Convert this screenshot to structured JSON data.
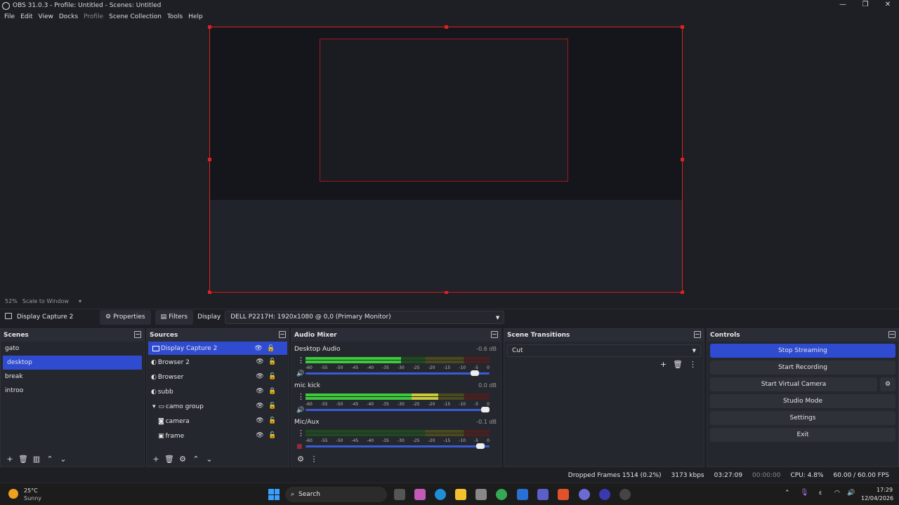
{
  "window": {
    "title": "OBS 31.0.3 - Profile: Untitled - Scenes: Untitled",
    "controls": [
      "—",
      "❐",
      "✕"
    ]
  },
  "menu": [
    "File",
    "Edit",
    "View",
    "Docks",
    "Profile",
    "Scene Collection",
    "Tools",
    "Help"
  ],
  "preview": {
    "zoom": "52%",
    "scale_mode": "Scale to Window"
  },
  "source_bar": {
    "source_name": "Display Capture 2",
    "properties_label": "Properties",
    "filters_label": "Filters",
    "display_label": "Display",
    "display_value": "DELL P2217H: 1920x1080 @ 0,0 (Primary Monitor)"
  },
  "scenes": {
    "title": "Scenes",
    "items": [
      "gato",
      "desktop",
      "break",
      "introo"
    ],
    "selected": "desktop"
  },
  "sources": {
    "title": "Sources",
    "items": [
      "Display Capture 2",
      "Browser 2",
      "Browser",
      "subb",
      "camo group",
      "camera",
      "frame"
    ]
  },
  "audio": {
    "title": "Audio Mixer",
    "channels": [
      {
        "name": "Desktop Audio",
        "db": "-0.6 dB",
        "level": 0.52,
        "volume": 0.94
      },
      {
        "name": "mic kick",
        "db": "0.0 dB",
        "level": 0.72,
        "volume": 1.0
      },
      {
        "name": "Mic/Aux",
        "db": "-0.1 dB",
        "level": 0.0,
        "volume": 0.97
      }
    ],
    "ticks": [
      "-60",
      "-55",
      "-50",
      "-45",
      "-40",
      "-35",
      "-30",
      "-25",
      "-20",
      "-15",
      "-10",
      "-5",
      "0"
    ]
  },
  "transitions": {
    "title": "Scene Transitions",
    "selected": "Cut"
  },
  "controls": {
    "title": "Controls",
    "buttons": [
      "Stop Streaming",
      "Start Recording",
      "Start Virtual Camera",
      "Studio Mode",
      "Settings",
      "Exit"
    ]
  },
  "status": {
    "dropped": "Dropped Frames 1514 (0.2%)",
    "bitrate": "3173 kbps",
    "stream_time": "03:27:09",
    "rec_time": "00:00:00",
    "cpu": "CPU: 4.8%",
    "fps": "60.00 / 60.00 FPS"
  },
  "taskbar": {
    "weather_temp": "25°C",
    "weather_desc": "Sunny",
    "search": "Search",
    "time": "17:29",
    "date": "12/04/2026"
  },
  "colors": {
    "accent": "#2f4bd0",
    "selection_border": "#e02020",
    "meter_green": "#3cc93c",
    "meter_yellow": "#c9c93c",
    "meter_red": "#c93c3c"
  }
}
